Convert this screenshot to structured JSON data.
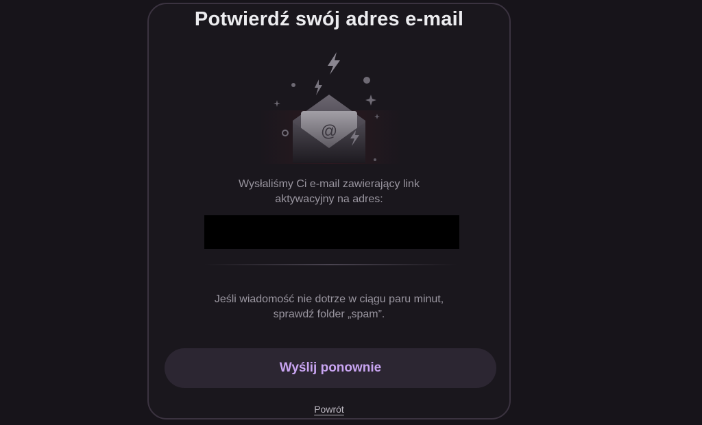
{
  "card": {
    "title": "Potwierdź swój adres e-mail",
    "info_line1": "Wysłaliśmy Ci e-mail zawierający link",
    "info_line2": "aktywacyjny na adres:",
    "email_value": "",
    "spam_line1": "Jeśli wiadomość nie dotrze w ciągu paru minut,",
    "spam_line2": "sprawdź folder „spam”.",
    "resend_label": "Wyślij ponownie",
    "back_label": "Powrót"
  },
  "illustration": {
    "envelope_symbol": "@",
    "icons": [
      "envelope-icon",
      "lightning-icon",
      "sparkle-icon"
    ]
  },
  "colors": {
    "background": "#17141a",
    "card_border": "#3b3340",
    "button_background": "#2c2632",
    "button_text": "#c9a5f2",
    "title_text": "#ececef",
    "body_text": "#9a96a0"
  }
}
